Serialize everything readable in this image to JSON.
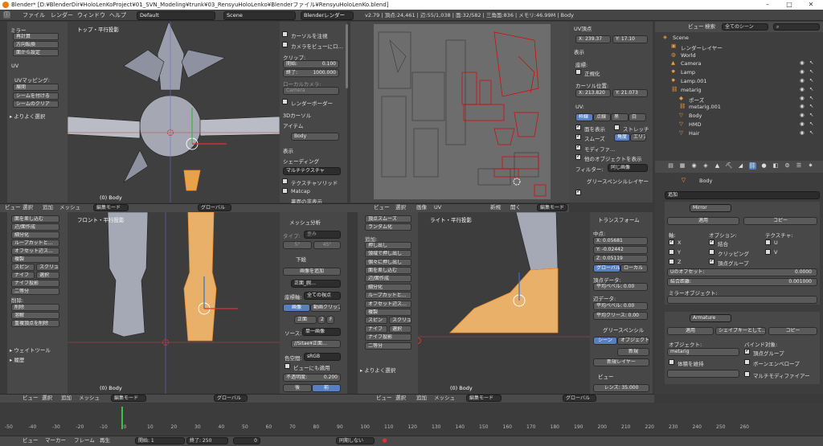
{
  "window": {
    "title": "Blender* [D:¥BlenderDir¥HoloLenKoProject¥01_SVN_Modeling¥trunk¥03_RensyuHoloLenko¥Blenderファイル¥RensyuHoloLenKo.blend]",
    "minimize": "–",
    "maximize": "□",
    "close": "✕"
  },
  "topbar": {
    "menus": [
      "ファイル",
      "レンダー",
      "ウィンドウ",
      "ヘルプ"
    ],
    "layout": "Default",
    "scene": "Scene",
    "engine": "Blenderレンダー",
    "stats": "v2.79 | 頂点:24,461 | 辺:55/1,038 | 面:32/582 | 三角面:836 | メモリ:46.99M | Body"
  },
  "colors": {
    "accent": "#5680c2",
    "selected": "#f28c28",
    "uv": "#e00000",
    "active": "#ffffff"
  },
  "tl_tools": {
    "head": "ミラー",
    "items": [
      "再計算",
      "方向転換",
      "面から設定"
    ],
    "uv_head": "UV",
    "uv_map": "UVマッピング:",
    "unwrap": "展開",
    "mark_seam": "シームを付ける",
    "clear_seam": "シームのクリア",
    "more": "▸ よりよく選択"
  },
  "tl_view": {
    "label": "トップ・平行投影",
    "obj": "(0) Body"
  },
  "tr_panel": {
    "cursor_limit": "カーソルを注視",
    "cam_to_view": "カメラをビューにロ…",
    "clip": "クリップ:",
    "start_label": "開始:",
    "start": "0.100",
    "end_label": "終了:",
    "end": "1000.000",
    "local_cam": "ローカルカメラ:",
    "camera": "Camera",
    "render_border": "レンダーボーダー",
    "cursor3d": "3Dカーソル",
    "item": "アイテム",
    "item_name": "Body",
    "display": "表示",
    "shading": "シェーディング",
    "texture": "マルチテクスチャ",
    "tex_solid": "テクスチャソリッド",
    "matcap": "Matcap",
    "backface": "裏面の非表示"
  },
  "uv_editor": {
    "head": "UV頂点",
    "x_label": "X:",
    "x": "239.37",
    "y_label": "Y:",
    "y": "17.10",
    "display": "表示",
    "coords": "座標:",
    "normalized": "正規化",
    "cursor_pos": "カーソル位置:",
    "cx": "X: 213.820",
    "cy": "Y: 21.073",
    "uv_label": "UV:",
    "modes": [
      "枠線",
      "点線",
      "黒",
      "白"
    ],
    "draw_faces": "面を表示",
    "stretch": "ストレッチ",
    "smooth": "スムーズ",
    "angle": "角度",
    "area": "エリア",
    "modified": "モディファ…",
    "other_objs": "他のオブジェクトを表示",
    "filter": "フィルター:",
    "filter_val": "同じ画像",
    "gp": "グリースペンシルレイヤー"
  },
  "outliner": {
    "view": "ビュー",
    "search": "検索",
    "filter": "全てのシーン",
    "items": [
      "Scene",
      "レンダーレイヤー",
      "World",
      "Camera",
      "Lamp",
      "Lamp.001",
      "metarig",
      "ポーズ",
      "metarig.001",
      "Body",
      "HMD",
      "Hair"
    ]
  },
  "properties": {
    "obj_name": "Body",
    "add": "追加",
    "mod1": "Mirror",
    "apply": "適用",
    "copy": "コピー",
    "axis": "軸:",
    "options": "オプション:",
    "texture": "テクスチャ:",
    "ax_x": "X",
    "ax_y": "Y",
    "ax_z": "Z",
    "merge": "結合",
    "clipping": "クリッピング",
    "vgroup": "頂点グループ",
    "tex_u": "U",
    "tex_v": "V",
    "u_offset_label": "Uのオフセット:",
    "u_offset": "0.0000",
    "merge_dist_label": "結合距離:",
    "merge_dist": "0.001000",
    "mirror_obj": "ミラーオブジェクト:",
    "mod2": "Armature",
    "apply2": "適用",
    "shapekey": "シェイプキーとして…",
    "copy2": "コピー",
    "object": "オブジェクト:",
    "obj_val": "metarig",
    "bind": "バインド対象:",
    "bind_vg": "頂点グループ",
    "preserve": "体積を維持",
    "bone_env": "ボーンエンベロープ",
    "multi": "マルチモディファイアー"
  },
  "bl_tools": {
    "items": [
      "面を差し込む",
      "辺/面作成",
      "細分化",
      "ループカットと…",
      "オフセット辺ス…",
      "複製",
      "スピン",
      "スクリュ",
      "ナイフ",
      "選択",
      "ナイフ投影",
      "二等分",
      "削除:",
      "削除",
      "溶解",
      "重複頂点を削除"
    ],
    "weight": "▸ ウェイトツール",
    "history": "▸ 履歴"
  },
  "bl_view": {
    "label": "フロント・平行投影",
    "obj": "(0) Body"
  },
  "bm_panel": {
    "mesh_analysis": "メッシュ分析",
    "type_label": "タイプ:",
    "type": "歪み",
    "min": "5°",
    "max": "45°",
    "background": "下絵",
    "add_image": "画像を追加",
    "img_name": "正面_腕…",
    "axis_label": "座標軸:",
    "axis": "全ての視点",
    "image": "画像",
    "movie": "動画クリップ",
    "front": "正面",
    "n2": "2",
    "f": "F",
    "source_label": "ソース:",
    "source": "単一画像",
    "file": "//Sitae¥正面…",
    "colorspace_label": "色空間:",
    "colorspace": "sRGB",
    "view_as": "ビューにも適用",
    "opacity_label": "不透明度:",
    "opacity": "0.200",
    "back": "後",
    "fore": "前"
  },
  "br_tools": {
    "items": [
      "頂点スムーズ",
      "ランダム化",
      "追加:",
      "押し出し",
      "領域で押し出し",
      "個々に押し出し",
      "面を差し込む",
      "辺/面作成",
      "細分化",
      "ループカットと…",
      "オフセット辺ス…",
      "複製",
      "スピン",
      "スクリュ",
      "ナイフ",
      "選択",
      "ナイフ投影",
      "二等分"
    ],
    "more": "▸ よりよく選択"
  },
  "br_view": {
    "label": "ライト・平行投影",
    "obj": "(0) Body"
  },
  "br_panel": {
    "transform": "トランスフォーム",
    "median": "中点:",
    "x": "X: 0.05681",
    "y": "Y: -0.02442",
    "z": "Z: 0.05119",
    "global": "グローバル",
    "local": "ローカル",
    "vdata": "頂点データ:",
    "bevel_w": "平均ベベル: 0.00",
    "edata": "辺データ:",
    "ebevel_w": "平均ベベル: 0.00",
    "crease": "平均クリース: 0.00",
    "gp": "グリースペンシル",
    "scene": "シーン",
    "object": "オブジェクト",
    "new": "新規",
    "new_layer": "新規レイヤー",
    "view": "ビュー",
    "lens": "レンズ: 35.000"
  },
  "hdr": {
    "view": "ビュー",
    "select": "選択",
    "add": "追加",
    "mesh": "メッシュ",
    "editmode": "編集モード",
    "global": "グローバル",
    "image": "画像",
    "uvs": "UV",
    "new": "新規",
    "open": "開く"
  },
  "timeline": {
    "ticks": [
      "-50",
      "-40",
      "-30",
      "-20",
      "-10",
      "0",
      "10",
      "20",
      "30",
      "40",
      "50",
      "60",
      "70",
      "80",
      "90",
      "100",
      "110",
      "120",
      "130",
      "140",
      "150",
      "160",
      "170",
      "180",
      "190",
      "200",
      "210",
      "220",
      "230",
      "240",
      "250",
      "260"
    ],
    "view": "ビュー",
    "marker": "マーカー",
    "frame": "フレーム",
    "play": "再生",
    "start": "開始: 1",
    "end": "終了: 250",
    "cur": "0",
    "sync": "同期しない"
  }
}
